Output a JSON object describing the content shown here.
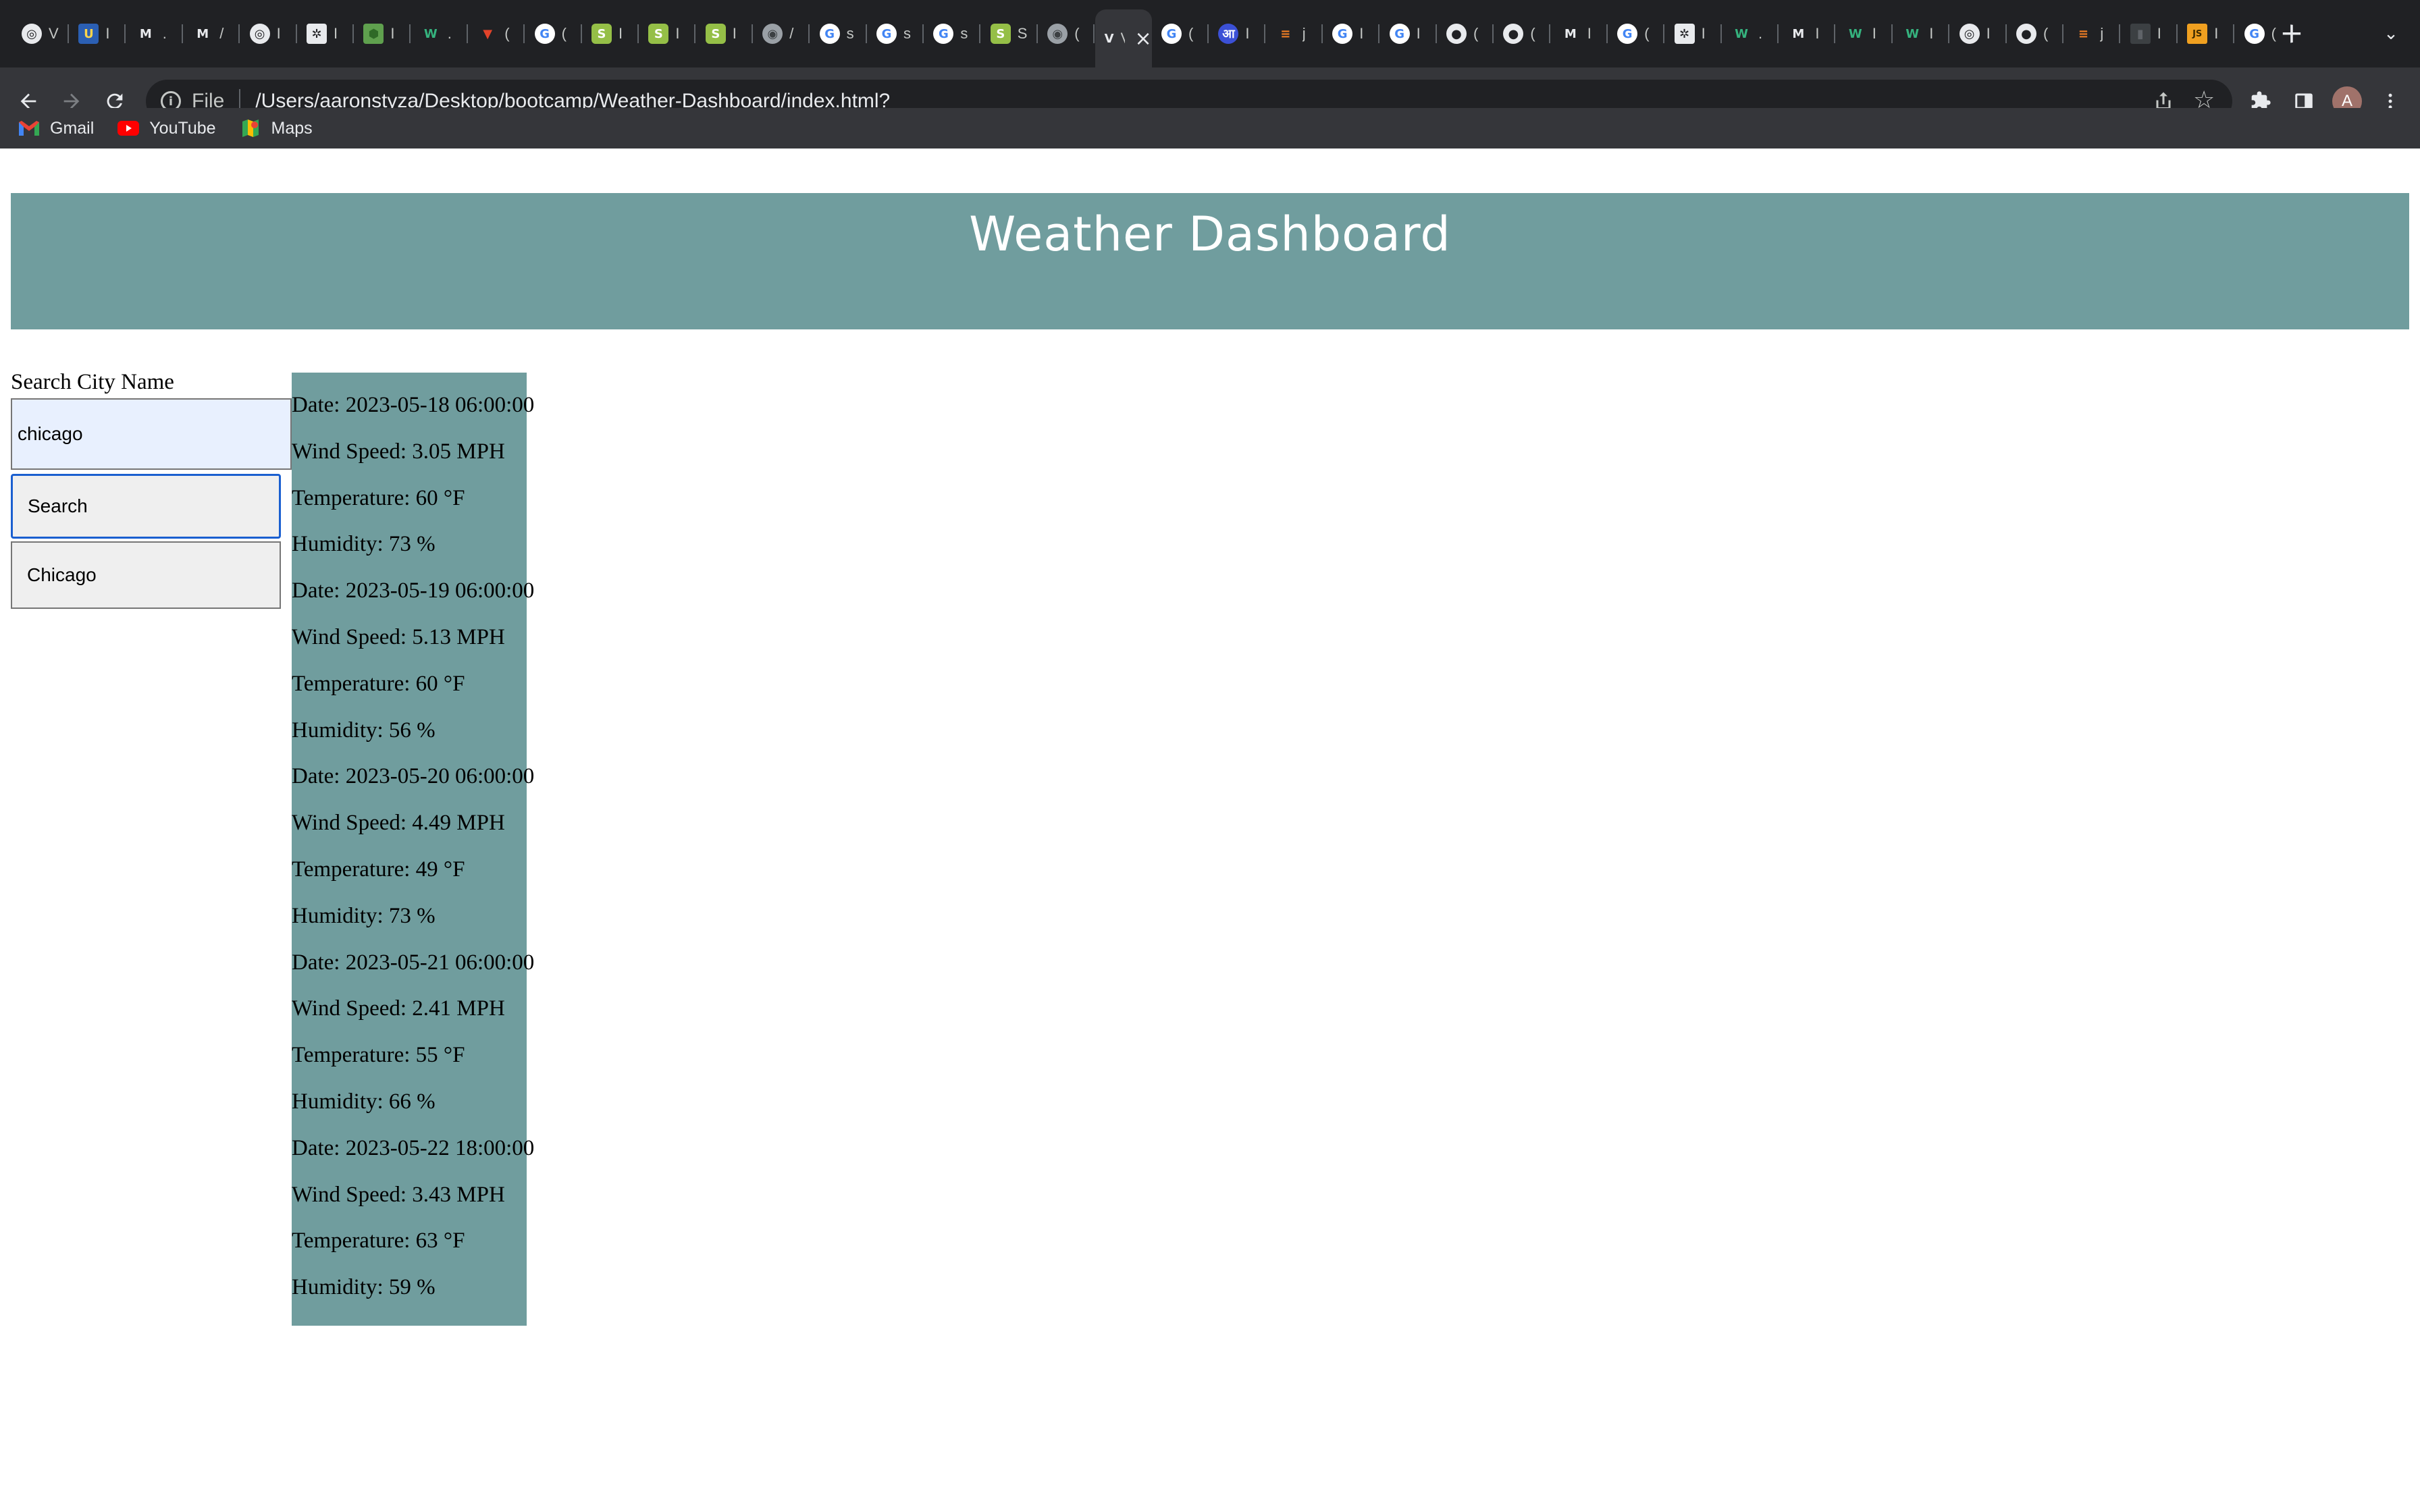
{
  "browser": {
    "tabs": [
      {
        "icon": "chrome-icon",
        "title": "V"
      },
      {
        "icon": "uc-icon",
        "title": "I"
      },
      {
        "icon": "m-icon",
        "title": "."
      },
      {
        "icon": "m-icon",
        "title": "/"
      },
      {
        "icon": "chrome-icon",
        "title": "I"
      },
      {
        "icon": "openai-icon",
        "title": "I"
      },
      {
        "icon": "node-icon",
        "title": "I"
      },
      {
        "icon": "w-icon",
        "title": "."
      },
      {
        "icon": "gitlab-icon",
        "title": "("
      },
      {
        "icon": "google-icon",
        "title": "("
      },
      {
        "icon": "shopify-icon",
        "title": "I"
      },
      {
        "icon": "shopify-icon",
        "title": "I"
      },
      {
        "icon": "shopify-icon",
        "title": "I"
      },
      {
        "icon": "globe-icon",
        "title": "/"
      },
      {
        "icon": "google-icon",
        "title": "s"
      },
      {
        "icon": "google-icon",
        "title": "s"
      },
      {
        "icon": "google-icon",
        "title": "s"
      },
      {
        "icon": "shopify-icon",
        "title": "S"
      },
      {
        "icon": "globe-icon",
        "title": "("
      },
      {
        "icon": "v-icon",
        "title": "V",
        "active": true
      },
      {
        "icon": "google-icon",
        "title": "("
      },
      {
        "icon": "aa-icon",
        "title": "I"
      },
      {
        "icon": "stackoverflow-icon",
        "title": "j"
      },
      {
        "icon": "google-icon",
        "title": "I"
      },
      {
        "icon": "google-icon",
        "title": "I"
      },
      {
        "icon": "github-icon",
        "title": "("
      },
      {
        "icon": "github-icon",
        "title": "("
      },
      {
        "icon": "m-icon",
        "title": "I"
      },
      {
        "icon": "google-icon",
        "title": "("
      },
      {
        "icon": "openai-icon",
        "title": "I"
      },
      {
        "icon": "w-icon",
        "title": "."
      },
      {
        "icon": "m-icon",
        "title": "I"
      },
      {
        "icon": "w-icon",
        "title": "I"
      },
      {
        "icon": "w-icon",
        "title": "I"
      },
      {
        "icon": "chrome-icon",
        "title": "I"
      },
      {
        "icon": "github-icon",
        "title": "("
      },
      {
        "icon": "stackoverflow-icon",
        "title": "j"
      },
      {
        "icon": "doc-icon",
        "title": "I"
      },
      {
        "icon": "js-icon",
        "title": "I"
      },
      {
        "icon": "google-icon",
        "title": "("
      }
    ],
    "address": {
      "scheme_label": "File",
      "url": "/Users/aaronstyza/Desktop/bootcamp/Weather-Dashboard/index.html?"
    },
    "avatar_initial": "A",
    "bookmarks": [
      {
        "label": "Gmail",
        "icon": "gmail-icon"
      },
      {
        "label": "YouTube",
        "icon": "youtube-icon"
      },
      {
        "label": "Maps",
        "icon": "maps-icon"
      }
    ]
  },
  "page": {
    "title": "Weather Dashboard",
    "search_label": "Search City Name",
    "search_input_value": "chicago",
    "search_button_label": "Search",
    "history": [
      "Chicago"
    ],
    "forecast": [
      {
        "date": "Date: 2023-05-18 06:00:00",
        "wind": "Wind Speed: 3.05 MPH",
        "temp": "Temperature: 60 °F",
        "humidity": "Humidity: 73 %"
      },
      {
        "date": "Date: 2023-05-19 06:00:00",
        "wind": "Wind Speed: 5.13 MPH",
        "temp": "Temperature: 60 °F",
        "humidity": "Humidity: 56 %"
      },
      {
        "date": "Date: 2023-05-20 06:00:00",
        "wind": "Wind Speed: 4.49 MPH",
        "temp": "Temperature: 49 °F",
        "humidity": "Humidity: 73 %"
      },
      {
        "date": "Date: 2023-05-21 06:00:00",
        "wind": "Wind Speed: 2.41 MPH",
        "temp": "Temperature: 55 °F",
        "humidity": "Humidity: 66 %"
      },
      {
        "date": "Date: 2023-05-22 18:00:00",
        "wind": "Wind Speed: 3.43 MPH",
        "temp": "Temperature: 63 °F",
        "humidity": "Humidity: 59 %"
      }
    ]
  },
  "colors": {
    "chrome_dark": "#202124",
    "chrome_toolbar": "#35363a",
    "header_bg": "#709d9e",
    "forecast_bg": "#709d9e",
    "input_bg": "#e8f0fe",
    "focus_ring": "#1a5fd0"
  }
}
